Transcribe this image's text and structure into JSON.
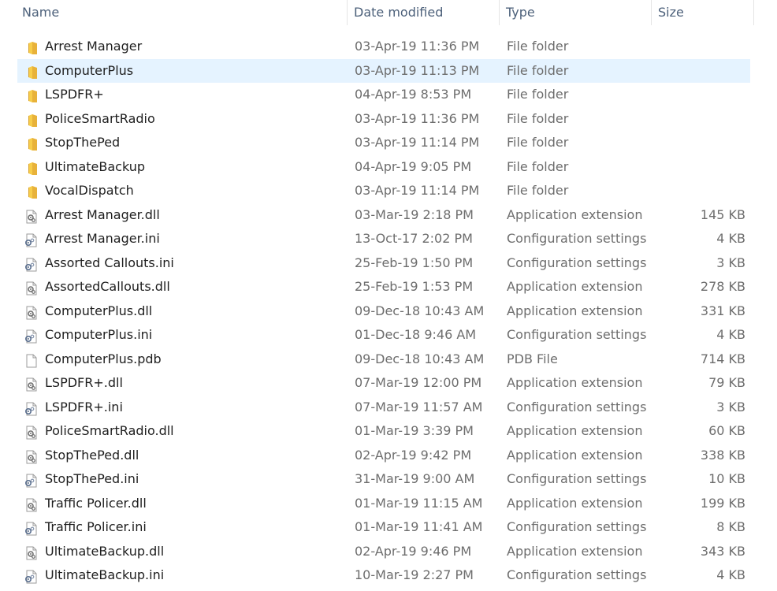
{
  "columns": {
    "name": "Name",
    "date": "Date modified",
    "type": "Type",
    "size": "Size"
  },
  "selected_index": 1,
  "files": [
    {
      "name": "Arrest Manager",
      "date": "03-Apr-19 11:36 PM",
      "type": "File folder",
      "size": "",
      "icon": "folder-icon"
    },
    {
      "name": "ComputerPlus",
      "date": "03-Apr-19 11:13 PM",
      "type": "File folder",
      "size": "",
      "icon": "folder-icon"
    },
    {
      "name": "LSPDFR+",
      "date": "04-Apr-19 8:53 PM",
      "type": "File folder",
      "size": "",
      "icon": "folder-icon"
    },
    {
      "name": "PoliceSmartRadio",
      "date": "03-Apr-19 11:36 PM",
      "type": "File folder",
      "size": "",
      "icon": "folder-icon"
    },
    {
      "name": "StopThePed",
      "date": "03-Apr-19 11:14 PM",
      "type": "File folder",
      "size": "",
      "icon": "folder-icon"
    },
    {
      "name": "UltimateBackup",
      "date": "04-Apr-19 9:05 PM",
      "type": "File folder",
      "size": "",
      "icon": "folder-icon"
    },
    {
      "name": "VocalDispatch",
      "date": "03-Apr-19 11:14 PM",
      "type": "File folder",
      "size": "",
      "icon": "folder-icon"
    },
    {
      "name": "Arrest Manager.dll",
      "date": "03-Mar-19 2:18 PM",
      "type": "Application extension",
      "size": "145 KB",
      "icon": "dll-file-icon"
    },
    {
      "name": "Arrest Manager.ini",
      "date": "13-Oct-17 2:02 PM",
      "type": "Configuration settings",
      "size": "4 KB",
      "icon": "ini-file-icon"
    },
    {
      "name": "Assorted Callouts.ini",
      "date": "25-Feb-19 1:50 PM",
      "type": "Configuration settings",
      "size": "3 KB",
      "icon": "ini-file-icon"
    },
    {
      "name": "AssortedCallouts.dll",
      "date": "25-Feb-19 1:53 PM",
      "type": "Application extension",
      "size": "278 KB",
      "icon": "dll-file-icon"
    },
    {
      "name": "ComputerPlus.dll",
      "date": "09-Dec-18 10:43 AM",
      "type": "Application extension",
      "size": "331 KB",
      "icon": "dll-file-icon"
    },
    {
      "name": "ComputerPlus.ini",
      "date": "01-Dec-18 9:46 AM",
      "type": "Configuration settings",
      "size": "4 KB",
      "icon": "ini-file-icon"
    },
    {
      "name": "ComputerPlus.pdb",
      "date": "09-Dec-18 10:43 AM",
      "type": "PDB File",
      "size": "714 KB",
      "icon": "blank-file-icon"
    },
    {
      "name": "LSPDFR+.dll",
      "date": "07-Mar-19 12:00 PM",
      "type": "Application extension",
      "size": "79 KB",
      "icon": "dll-file-icon"
    },
    {
      "name": "LSPDFR+.ini",
      "date": "07-Mar-19 11:57 AM",
      "type": "Configuration settings",
      "size": "3 KB",
      "icon": "ini-file-icon"
    },
    {
      "name": "PoliceSmartRadio.dll",
      "date": "01-Mar-19 3:39 PM",
      "type": "Application extension",
      "size": "60 KB",
      "icon": "dll-file-icon"
    },
    {
      "name": "StopThePed.dll",
      "date": "02-Apr-19 9:42 PM",
      "type": "Application extension",
      "size": "338 KB",
      "icon": "dll-file-icon"
    },
    {
      "name": "StopThePed.ini",
      "date": "31-Mar-19 9:00 AM",
      "type": "Configuration settings",
      "size": "10 KB",
      "icon": "ini-file-icon"
    },
    {
      "name": "Traffic Policer.dll",
      "date": "01-Mar-19 11:15 AM",
      "type": "Application extension",
      "size": "199 KB",
      "icon": "dll-file-icon"
    },
    {
      "name": "Traffic Policer.ini",
      "date": "01-Mar-19 11:41 AM",
      "type": "Configuration settings",
      "size": "8 KB",
      "icon": "ini-file-icon"
    },
    {
      "name": "UltimateBackup.dll",
      "date": "02-Apr-19 9:46 PM",
      "type": "Application extension",
      "size": "343 KB",
      "icon": "dll-file-icon"
    },
    {
      "name": "UltimateBackup.ini",
      "date": "10-Mar-19 2:27 PM",
      "type": "Configuration settings",
      "size": "4 KB",
      "icon": "ini-file-icon"
    }
  ]
}
